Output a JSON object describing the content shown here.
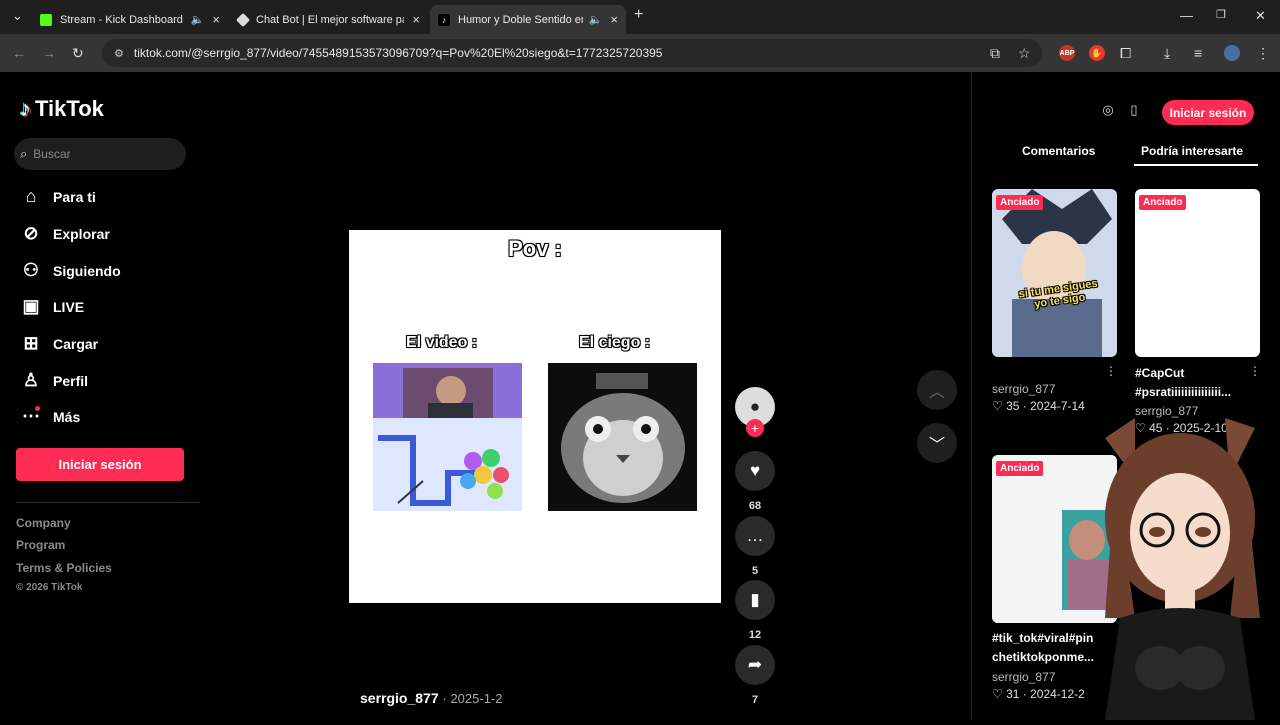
{
  "browser": {
    "tabs": [
      {
        "title": "Stream - Kick Dashboard"
      },
      {
        "title": "Chat Bot | El mejor software pa"
      },
      {
        "title": "Humor y Doble Sentido en"
      }
    ],
    "url": "tiktok.com/@serrgio_877/video/7455489153573096709?q=Pov%20El%20siego&t=1772325720395"
  },
  "sidebar": {
    "logo": "TikTok",
    "search_placeholder": "Buscar",
    "nav": [
      {
        "label": "Para ti"
      },
      {
        "label": "Explorar"
      },
      {
        "label": "Siguiendo"
      },
      {
        "label": "LIVE"
      },
      {
        "label": "Cargar"
      },
      {
        "label": "Perfil"
      },
      {
        "label": "Más"
      }
    ],
    "login": "Iniciar sesión",
    "footer": [
      "Company",
      "Program",
      "Terms & Policies"
    ],
    "copyright": "© 2026 TikTok"
  },
  "video": {
    "title": "Pov :",
    "label_left": "El video :",
    "label_right": "El ciego :",
    "author": "serrgio_877",
    "date": "· 2025-1-2"
  },
  "actions": {
    "likes": "68",
    "comments": "5",
    "saves": "12",
    "shares": "7"
  },
  "right": {
    "login": "Iniciar sesión",
    "tab_comments": "Comentarios",
    "tab_suggest": "Podría interesarte",
    "cards": [
      {
        "pin": "Anciado",
        "overlay": "si tu me sigues yo te sigo",
        "author": "serrgio_877",
        "stats": "♡ 35 · 2024-7-14"
      },
      {
        "pin": "Anciado",
        "title1": "#CapCut",
        "title2": "#psratiiiiiiiiiiiiiii...",
        "author": "serrgio_877",
        "stats": "♡ 45 · 2025-2-10"
      },
      {
        "pin": "Anciado",
        "title1": "#tik_tok#viral#pin",
        "title2": "chetiktokponme...",
        "author": "serrgio_877",
        "stats": "♡ 31 · 2024-12-2"
      }
    ]
  },
  "colors": {
    "accent": "#fe2c55"
  }
}
